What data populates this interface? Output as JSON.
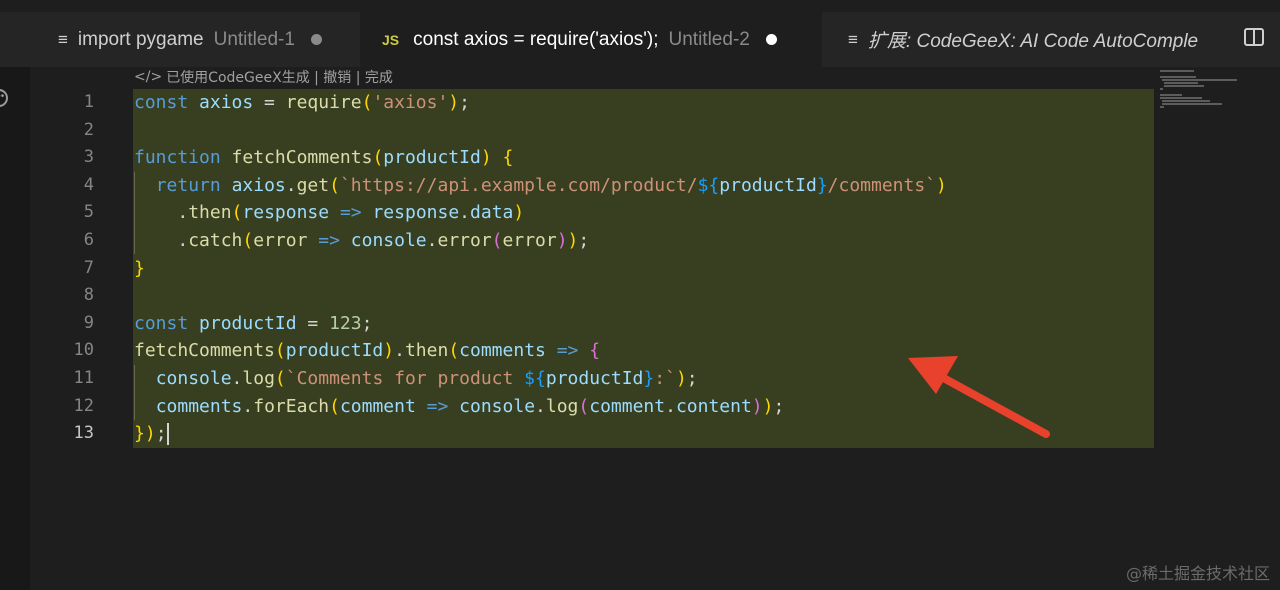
{
  "tabs": [
    {
      "icon": "lines-file-icon",
      "title": "import pygame",
      "desc": "Untitled-1",
      "modified": true,
      "active": false
    },
    {
      "icon": "js-file-icon",
      "icon_text": "JS",
      "title": "const axios = require('axios');",
      "desc": "Untitled-2",
      "modified": true,
      "active": true
    },
    {
      "icon": "lines-file-icon",
      "title": "扩展: CodeGeeX: AI Code AutoComple",
      "active": false
    }
  ],
  "codelens": {
    "text": "已使用CodeGeeX生成 | 撤销 | 完成"
  },
  "editor": {
    "current_line": 13,
    "line_numbers": [
      "1",
      "2",
      "3",
      "4",
      "5",
      "6",
      "7",
      "8",
      "9",
      "10",
      "11",
      "12",
      "13"
    ],
    "code_lines": [
      "const axios = require('axios');",
      "",
      "function fetchComments(productId) {",
      "  return axios.get(`https://api.example.com/product/${productId}/comments`)",
      "    .then(response => response.data)",
      "    .catch(error => console.error(error));",
      "}",
      "",
      "const productId = 123;",
      "fetchComments(productId).then(comments => {",
      "  console.log(`Comments for product ${productId}:`);",
      "  comments.forEach(comment => console.log(comment.content));",
      "});"
    ]
  },
  "annotation": {
    "type": "arrow",
    "color": "#e8412c",
    "points_to": "generated code block"
  },
  "watermark": "@稀土掘金技术社区",
  "colors": {
    "editor_bg": "#1e1e1e",
    "highlight_bg": "#383f21",
    "keyword": "#569cd6",
    "string": "#ce9178",
    "function": "#dcdcaa",
    "variable": "#9cdcfe"
  }
}
